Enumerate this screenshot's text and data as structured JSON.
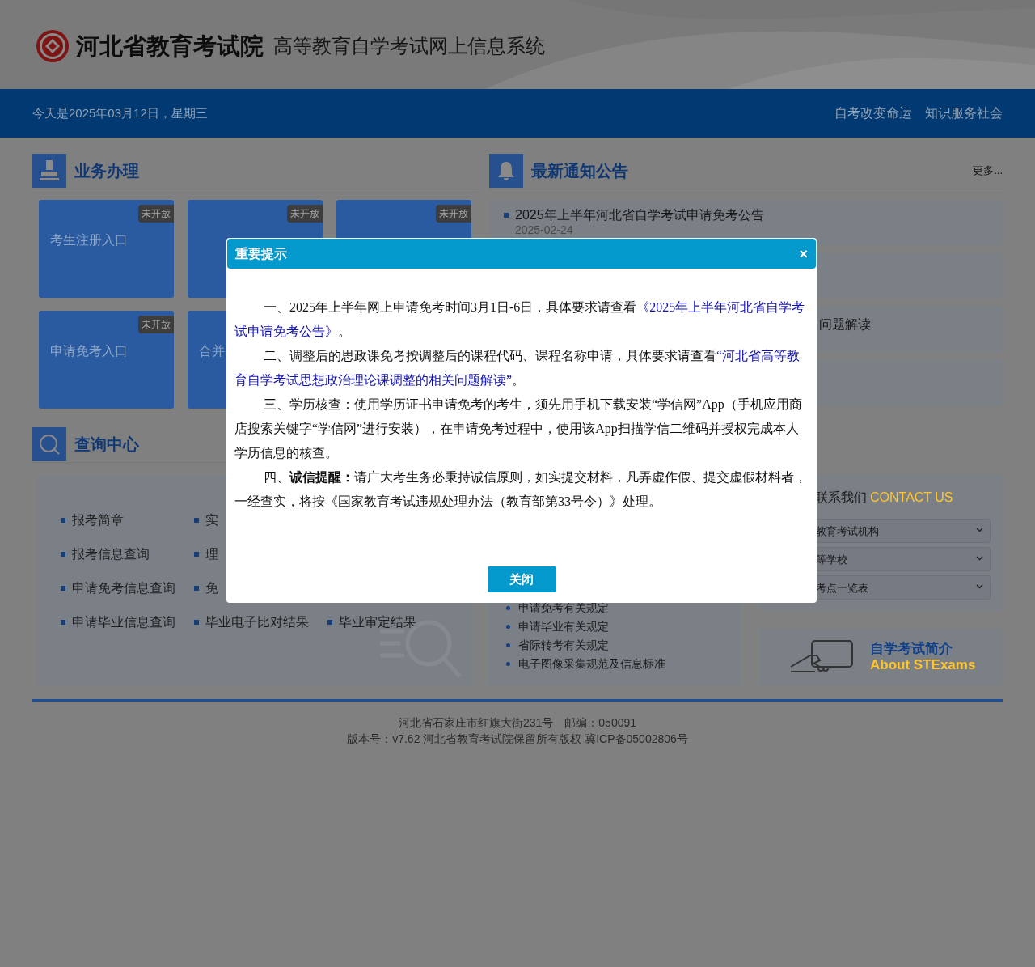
{
  "header": {
    "org": "河北省教育考试院",
    "system": "高等教育自学考试网上信息系统"
  },
  "topbar": {
    "date": "今天是2025年03月12日，星期三",
    "links": [
      "自考改变命运",
      "知识服务社会"
    ]
  },
  "business": {
    "title": "业务办理",
    "tiles": [
      {
        "label": "考生注册入口",
        "badge": "未开放"
      },
      {
        "badge": "未开放"
      },
      {
        "badge": "未开放"
      },
      {
        "label": "申请免考入口",
        "badge": "未开放"
      },
      {
        "label": "合并"
      }
    ]
  },
  "notices": {
    "title": "最新通知公告",
    "more": "更多...",
    "items": [
      {
        "kind": "notice",
        "title": "2025年上半年河北省自学考试申请免考公告",
        "date": "2025-02-24"
      },
      {
        "kind": "blank"
      },
      {
        "kind": "partial",
        "title": "问题解读"
      },
      {
        "kind": "blank"
      }
    ]
  },
  "query": {
    "title": "查询中心",
    "rows": [
      {
        "cells": [
          "报考简章",
          "实"
        ]
      },
      {
        "cells": [
          "报考信息查询",
          "理"
        ]
      },
      {
        "cells": [
          "申请免考信息查询",
          "免"
        ]
      },
      {
        "cells": [
          "申请毕业信息查询",
          "毕业电子比对结果",
          "毕业审定结果"
        ]
      }
    ]
  },
  "rules": {
    "items": [
      "申请免考有关规定",
      "申请毕业有关规定",
      "省际转考有关规定",
      "电子图像采集规范及信息标准"
    ]
  },
  "contact": {
    "title": "联系我们",
    "title_en": "CONTACT US",
    "selects": [
      "教育考试机构",
      "等学校",
      "考点一览表"
    ]
  },
  "about": {
    "title": "自学考试简介",
    "title_en": "About STExams"
  },
  "footer": {
    "lines": [
      "河北省石家庄市红旗大街231号　邮编：050091",
      "版本号：v7.62 河北省教育考试院保留所有版权 冀ICP备05002806号"
    ]
  },
  "modal": {
    "title": "重要提示",
    "close": "×",
    "paragraphs": [
      [
        {
          "kind": "text",
          "text": "一、2025年上半年网上申请免考时间3月1日-6日，具体要求请查看"
        },
        {
          "kind": "link",
          "text": "《2025年上半年河北省自学考"
        },
        {
          "kind": "link",
          "text": "试申请免考公告》"
        },
        {
          "kind": "text",
          "text": "。"
        }
      ],
      [
        {
          "kind": "text",
          "text": "二、调整后的思政课免考按调整后的课程代码、课程名称申请，具体要求请查看"
        },
        {
          "kind": "link",
          "text": "“河北省高等教"
        },
        {
          "kind": "link",
          "text": "育自学考试思想政治理论课调整的相关问题解读”"
        },
        {
          "kind": "text",
          "text": "。"
        }
      ],
      [
        {
          "kind": "text",
          "text": "三、学历核查：使用学历证书申请免考的考生，须先用手机下载安装“学信网”App（手机应用商店搜索关键字“学信网”进行安装），在申请免考过程中，使用该App扫描学信二维码并授权完成本人学历信息的核查。"
        }
      ],
      [
        {
          "kind": "text",
          "text": "四、**诚信提醒：**请广大考生务必秉持诚信原则，如实提交材料，凡弄虚作假、提交虚假材料者，一经查实，将按《国家教育考试违规处理办法（教育部第33号令）》处理。"
        }
      ]
    ],
    "button": "关闭"
  }
}
